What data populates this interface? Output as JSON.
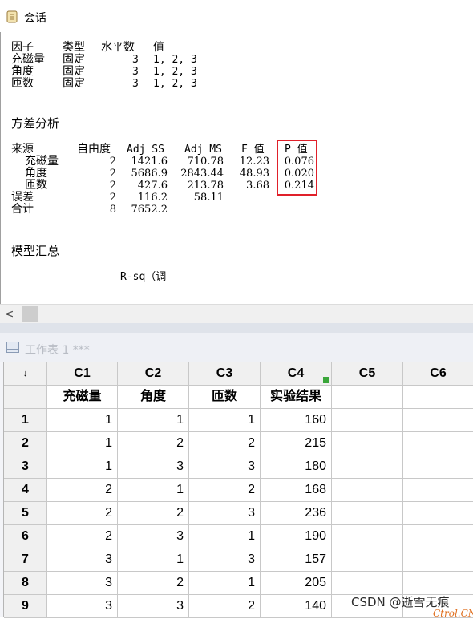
{
  "session": {
    "title": "会话",
    "factor_header": {
      "factor": "因子",
      "type": "类型",
      "levels": "水平数",
      "values": "值"
    },
    "factors": [
      {
        "name": "充磁量",
        "type": "固定",
        "levels": "3",
        "values": "1, 2, 3"
      },
      {
        "name": "角度",
        "type": "固定",
        "levels": "3",
        "values": "1, 2, 3"
      },
      {
        "name": "匝数",
        "type": "固定",
        "levels": "3",
        "values": "1, 2, 3"
      }
    ],
    "anova_title": "方差分析",
    "anova_header": {
      "source": "来源",
      "df": "自由度",
      "adjss": "Adj SS",
      "adjms": "Adj MS",
      "f": "F 值",
      "p": "P 值"
    },
    "anova_rows": [
      {
        "source": "充磁量",
        "df": "2",
        "adjss": "1421.6",
        "adjms": "710.78",
        "f": "12.23",
        "p": "0.076"
      },
      {
        "source": "角度",
        "df": "2",
        "adjss": "5686.9",
        "adjms": "2843.44",
        "f": "48.93",
        "p": "0.020"
      },
      {
        "source": "匝数",
        "df": "2",
        "adjss": "427.6",
        "adjms": "213.78",
        "f": "3.68",
        "p": "0.214"
      },
      {
        "source": "误差",
        "df": "2",
        "adjss": "116.2",
        "adjms": "58.11",
        "f": "",
        "p": ""
      },
      {
        "source": "合计",
        "df": "8",
        "adjss": "7652.2",
        "adjms": "",
        "f": "",
        "p": ""
      }
    ],
    "model_summary_title": "模型汇总",
    "rsq_partial": "R-sq（调",
    "scroll_left": "<"
  },
  "worksheet": {
    "title": "工作表 1 ***",
    "corner": "↓",
    "columns": [
      "C1",
      "C2",
      "C3",
      "C4",
      "C5",
      "C6"
    ],
    "col_names": [
      "充磁量",
      "角度",
      "匝数",
      "实验结果",
      "",
      ""
    ],
    "row_labels": [
      "1",
      "2",
      "3",
      "4",
      "5",
      "6",
      "7",
      "8",
      "9"
    ],
    "rows": [
      [
        "1",
        "1",
        "1",
        "160"
      ],
      [
        "1",
        "2",
        "2",
        "215"
      ],
      [
        "1",
        "3",
        "3",
        "180"
      ],
      [
        "2",
        "1",
        "2",
        "168"
      ],
      [
        "2",
        "2",
        "3",
        "236"
      ],
      [
        "2",
        "3",
        "1",
        "190"
      ],
      [
        "3",
        "1",
        "3",
        "157"
      ],
      [
        "3",
        "2",
        "1",
        "205"
      ],
      [
        "3",
        "3",
        "2",
        "140"
      ]
    ]
  },
  "watermark": {
    "csdn": "CSDN @逝雪无痕",
    "ctrl": "Ctrol.CN"
  },
  "colors": {
    "highlight_box": "#e0202a",
    "c4_flag": "#3aa63a"
  }
}
